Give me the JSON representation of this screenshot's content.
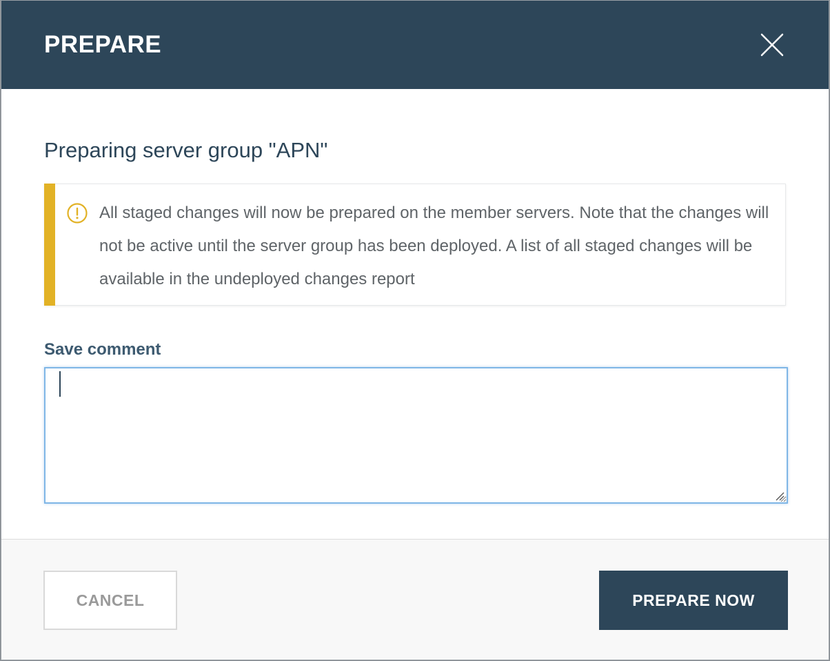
{
  "dialog": {
    "title": "PREPARE",
    "close_icon": "close-icon",
    "heading": "Preparing server group \"APN\"",
    "alert": {
      "icon": "warning-circle-icon",
      "color": "#e2b226",
      "message": "All staged changes will now be prepared on the member servers. Note that the changes will not be active until the server group has been deployed. A list of all staged changes will be available in the undeployed changes report"
    },
    "comment": {
      "label": "Save comment",
      "value": "",
      "placeholder": ""
    },
    "footer": {
      "cancel_label": "CANCEL",
      "submit_label": "PREPARE NOW"
    }
  },
  "colors": {
    "header_bg": "#2d4659",
    "primary_button": "#2d4659",
    "alert_accent": "#e2b226",
    "focus_border": "#7fb6e6"
  }
}
